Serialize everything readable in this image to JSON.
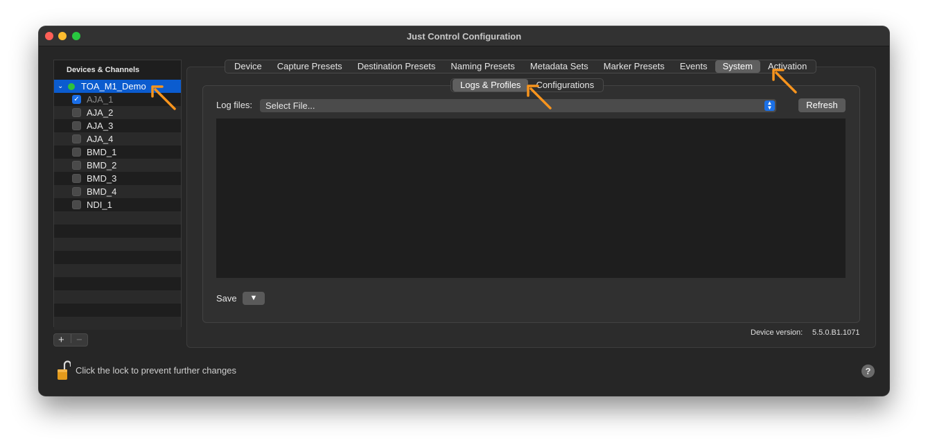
{
  "window": {
    "title": "Just Control Configuration"
  },
  "sidebar": {
    "header": "Devices & Channels",
    "device": {
      "label": "TOA_M1_Demo",
      "status_color": "#2fc23c"
    },
    "channels": [
      {
        "label": "AJA_1",
        "checked": true
      },
      {
        "label": "AJA_2",
        "checked": false
      },
      {
        "label": "AJA_3",
        "checked": false
      },
      {
        "label": "AJA_4",
        "checked": false
      },
      {
        "label": "BMD_1",
        "checked": false
      },
      {
        "label": "BMD_2",
        "checked": false
      },
      {
        "label": "BMD_3",
        "checked": false
      },
      {
        "label": "BMD_4",
        "checked": false
      },
      {
        "label": "NDI_1",
        "checked": false
      }
    ],
    "add_label": "+",
    "remove_label": "−"
  },
  "tabs": [
    {
      "label": "Device"
    },
    {
      "label": "Capture Presets"
    },
    {
      "label": "Destination Presets"
    },
    {
      "label": "Naming Presets"
    },
    {
      "label": "Metadata Sets"
    },
    {
      "label": "Marker Presets"
    },
    {
      "label": "Events"
    },
    {
      "label": "System",
      "active": true
    },
    {
      "label": "Activation"
    }
  ],
  "subtabs": [
    {
      "label": "Logs & Profiles",
      "active": true
    },
    {
      "label": "Configurations"
    }
  ],
  "logs": {
    "label": "Log files:",
    "select_value": "Select File...",
    "refresh_label": "Refresh",
    "save_label": "Save",
    "save_menu_glyph": "▼"
  },
  "footer": {
    "device_version_label": "Device version:",
    "device_version_value": "5.5.0.B1.1071",
    "lock_text": "Click the lock to prevent further changes",
    "help_label": "?"
  },
  "colors": {
    "accent": "#0b5ccf",
    "annotation_arrow": "#f7941d"
  }
}
